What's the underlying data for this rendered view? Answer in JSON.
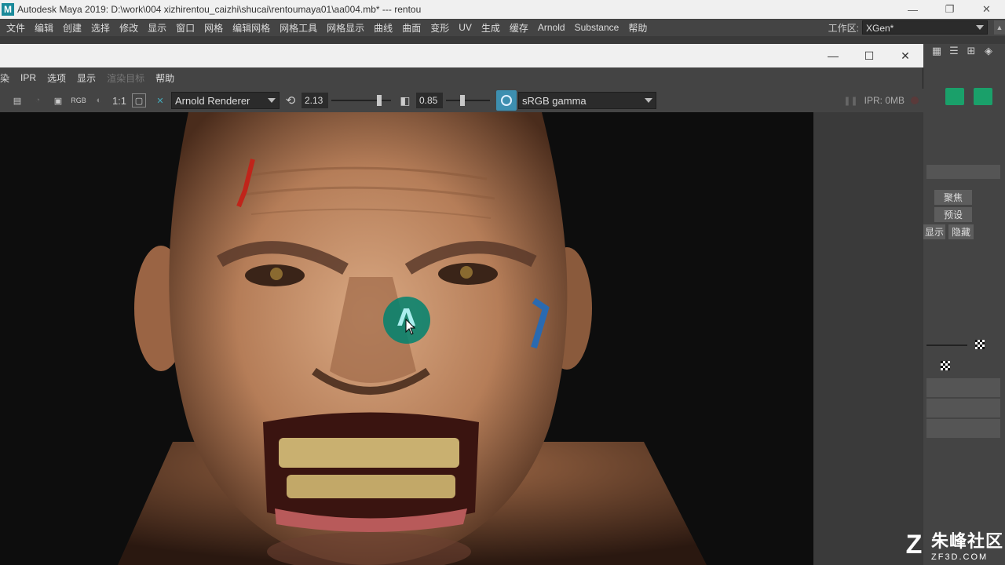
{
  "app": {
    "title": "Autodesk Maya 2019: D:\\work\\004 xizhirentou_caizhi\\shucai\\rentoumaya01\\aa004.mb*   ---   rentou",
    "logo_letter": "M",
    "window_controls": [
      "—",
      "❐",
      "✕"
    ]
  },
  "menubar": {
    "items": [
      "文件",
      "编辑",
      "创建",
      "选择",
      "修改",
      "显示",
      "窗口",
      "网格",
      "编辑网格",
      "网格工具",
      "网格显示",
      "曲线",
      "曲面",
      "变形",
      "UV",
      "生成",
      "缓存",
      "Arnold",
      "Substance",
      "帮助"
    ],
    "workspace_label": "工作区:",
    "workspace_value": "XGen*"
  },
  "render_view": {
    "window_controls": [
      "—",
      "☐",
      "✕"
    ],
    "menu": [
      "染",
      "IPR",
      "选项",
      "显示",
      "渲染目标",
      "帮助"
    ],
    "toolbar": {
      "ratio_label": "1:1",
      "rgb_label": "RGB",
      "renderer": "Arnold Renderer",
      "exposure": "2.13",
      "gamma": "0.85",
      "color_space": "sRGB gamma",
      "ipr_status": "IPR: 0MB"
    }
  },
  "right_panel": {
    "focus_label": "聚焦",
    "preset_label": "预设",
    "show_label": "显示",
    "hide_label": "隐藏"
  },
  "watermark": {
    "cn": "朱峰社区",
    "en": "ZF3D.COM",
    "logo": "Z"
  },
  "colors": {
    "panel": "#444444",
    "titlebar": "#f0f0f0",
    "accent_teal": "#1a8a9a",
    "canvas": "#0d0d0d",
    "click_indicator": "#00826e"
  }
}
